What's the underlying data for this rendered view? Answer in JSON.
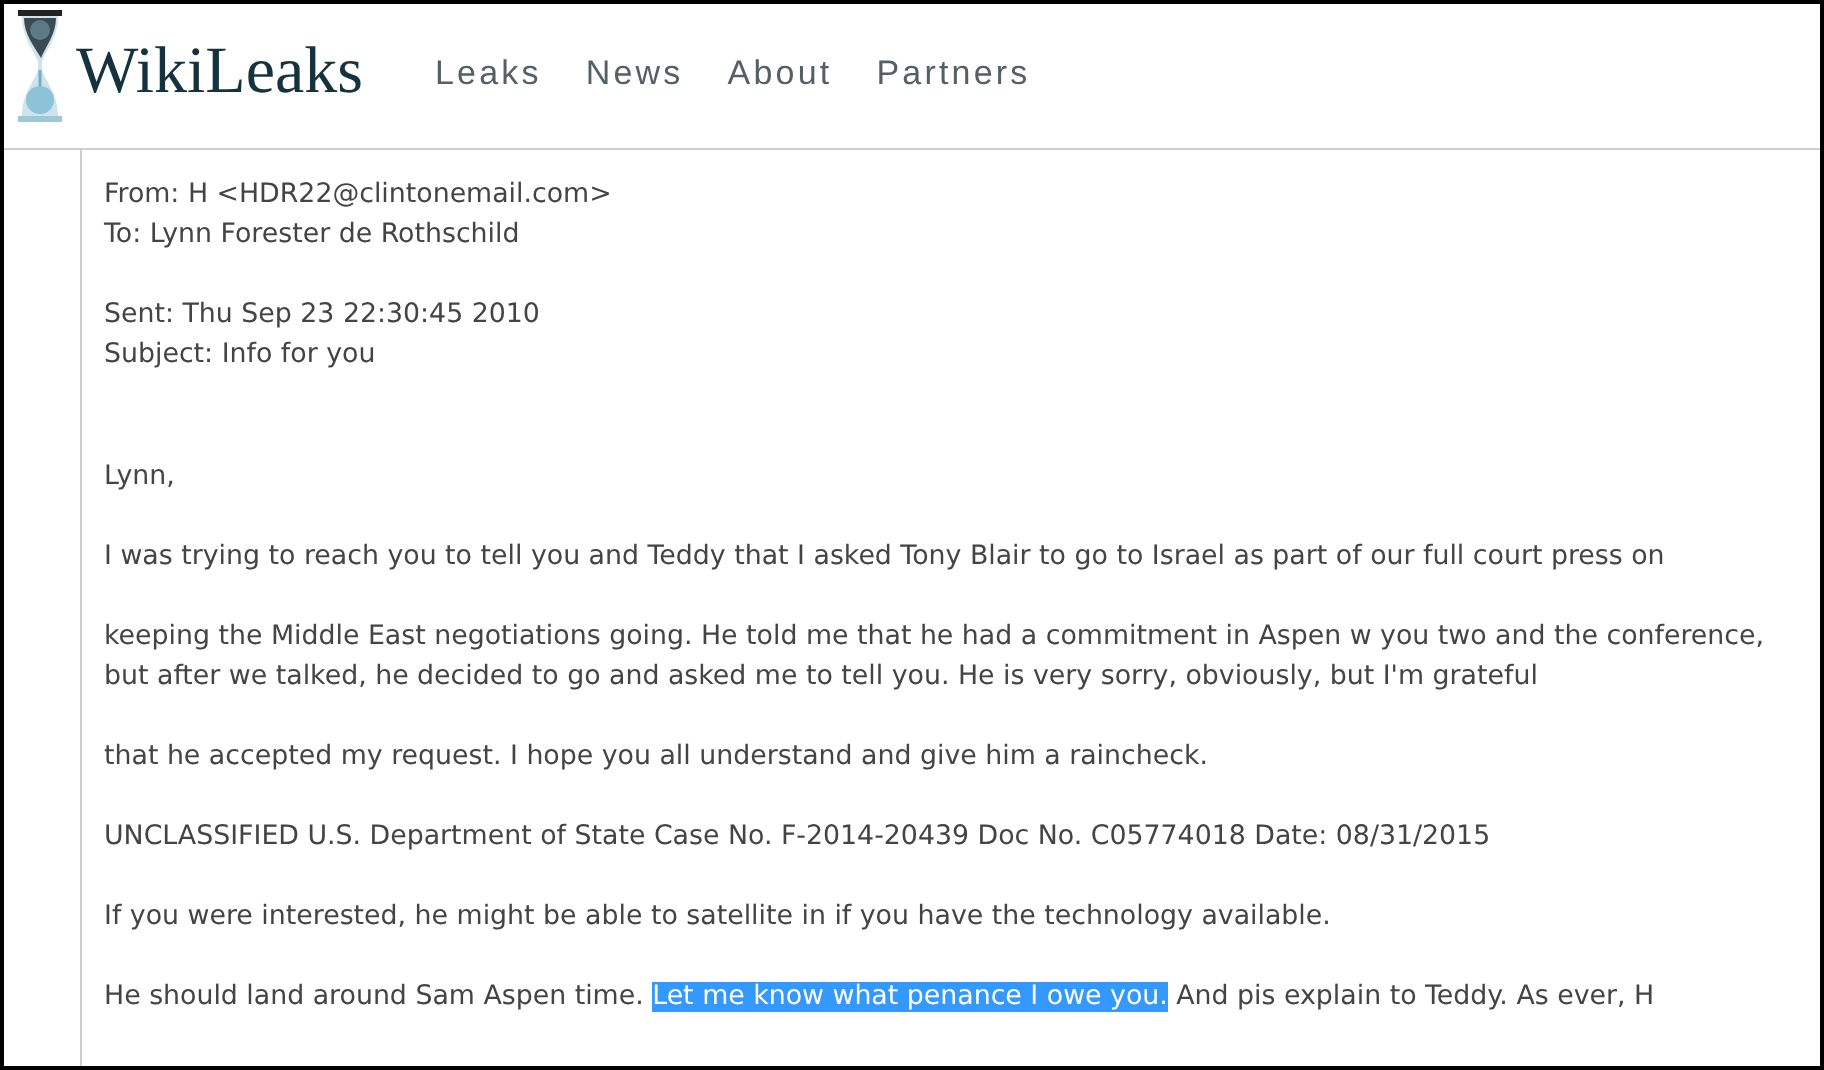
{
  "site": {
    "name": "WikiLeaks"
  },
  "nav": [
    {
      "label": "Leaks"
    },
    {
      "label": "News"
    },
    {
      "label": "About"
    },
    {
      "label": "Partners"
    }
  ],
  "email": {
    "header_groups": [
      [
        "From: H <HDR22@clintonemail.com>",
        "To: Lynn Forester de Rothschild"
      ],
      [
        "Sent: Thu Sep 23 22:30:45 2010",
        "Subject: Info for you"
      ]
    ],
    "body": [
      {
        "segments": [
          {
            "text": "Lynn,",
            "selected": false
          }
        ]
      },
      {
        "segments": [
          {
            "text": "I was trying to reach you to tell you and Teddy that I asked Tony Blair to go to Israel as part of our full court press on",
            "selected": false
          }
        ]
      },
      {
        "segments": [
          {
            "text": "keeping the Middle East negotiations going. He told me that he had a commitment in Aspen w you two and the conference, but after we talked, he decided to go and asked me to tell you. He is very sorry, obviously, but I'm grateful",
            "selected": false
          }
        ]
      },
      {
        "segments": [
          {
            "text": "that he accepted my request. I hope you all understand and give him a raincheck.",
            "selected": false
          }
        ]
      },
      {
        "segments": [
          {
            "text": "UNCLASSIFIED U.S. Department of State Case No. F-2014-20439 Doc No. C05774018 Date: 08/31/2015",
            "selected": false
          }
        ]
      },
      {
        "segments": [
          {
            "text": "If you were interested, he might be able to satellite in if you have the technology available.",
            "selected": false
          }
        ]
      },
      {
        "segments": [
          {
            "text": "He should land around Sam Aspen time. ",
            "selected": false
          },
          {
            "text": "Let me know what penance I owe you.",
            "selected": true
          },
          {
            "text": " And pis explain to Teddy. As ever, H",
            "selected": false
          }
        ]
      }
    ]
  }
}
